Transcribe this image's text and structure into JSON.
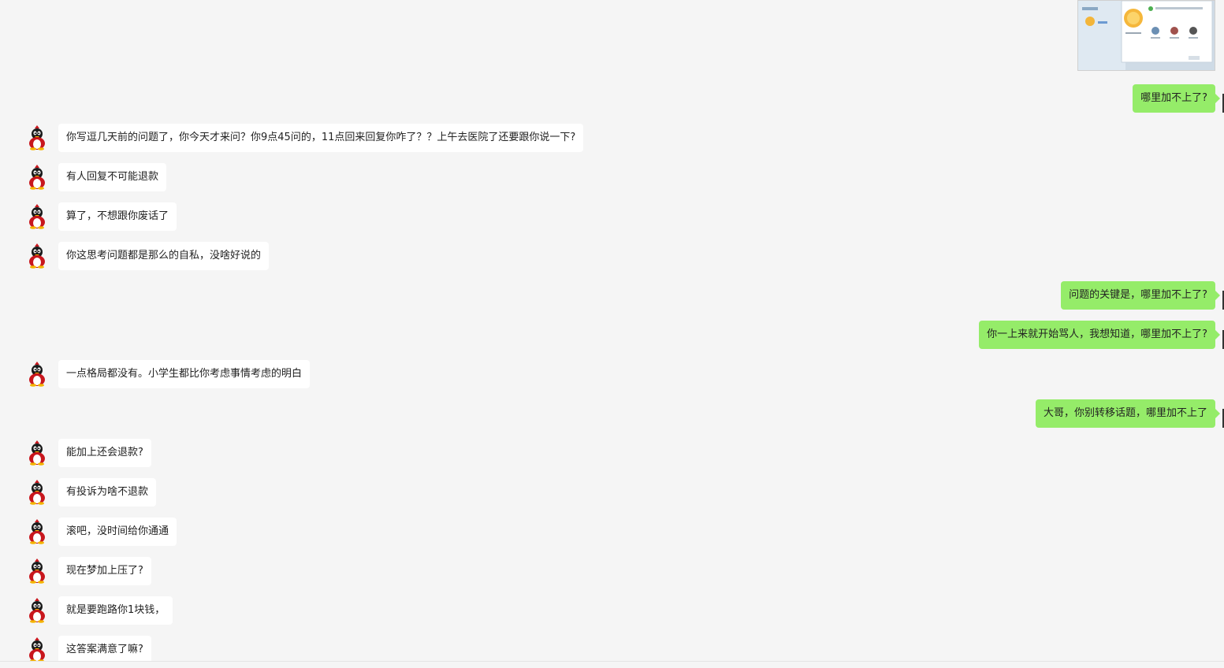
{
  "messages": [
    {
      "side": "out",
      "type": "image",
      "text": ""
    },
    {
      "side": "out",
      "type": "text",
      "text": "哪里加不上了?"
    },
    {
      "side": "in",
      "type": "text",
      "text": "你写逗几天前的问题了，你今天才来问？你9点45问的，11点回来回复你咋了？？上午去医院了还要跟你说一下?"
    },
    {
      "side": "in",
      "type": "text",
      "text": "有人回复不可能退款"
    },
    {
      "side": "in",
      "type": "text",
      "text": "算了，不想跟你废话了"
    },
    {
      "side": "in",
      "type": "text",
      "text": "你这思考问题都是那么的自私，没啥好说的"
    },
    {
      "side": "out",
      "type": "text",
      "text": "问题的关键是，哪里加不上了?"
    },
    {
      "side": "out",
      "type": "text",
      "text": "你一上来就开始骂人，我想知道，哪里加不上了?"
    },
    {
      "side": "in",
      "type": "text",
      "text": "一点格局都没有。小学生都比你考虑事情考虑的明白"
    },
    {
      "side": "out",
      "type": "text",
      "text": "大哥，你别转移话题，哪里加不上了"
    },
    {
      "side": "in",
      "type": "text",
      "text": "能加上还会退款?"
    },
    {
      "side": "in",
      "type": "text",
      "text": "有投诉为啥不退款"
    },
    {
      "side": "in",
      "type": "text",
      "text": "滚吧，没时间给你通通"
    },
    {
      "side": "in",
      "type": "text",
      "text": "现在梦加上压了?"
    },
    {
      "side": "in",
      "type": "text",
      "text": "就是要跑路你1块钱，"
    },
    {
      "side": "in",
      "type": "text",
      "text": "这答案满意了嘛?"
    }
  ],
  "colors": {
    "background": "#f5f5f5",
    "outgoing_bubble": "#95ec69",
    "incoming_bubble": "#ffffff",
    "avatar_body": "#c8161d"
  },
  "icons": {
    "avatar": "qq-penguin-avatar-icon",
    "thumbnail": "screenshot-thumbnail"
  }
}
